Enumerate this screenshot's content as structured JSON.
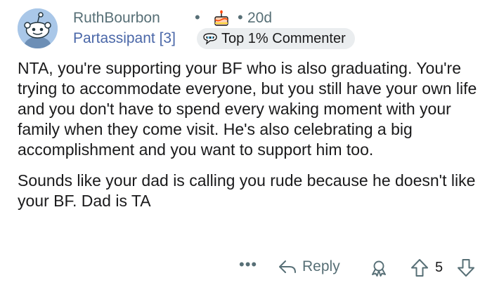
{
  "comment": {
    "author": {
      "username": "RuthBourbon",
      "flair": "Partassipant [3]",
      "badge": "Top 1% Commenter",
      "age": "20d",
      "separator": "•"
    },
    "body": {
      "paragraph1": "NTA, you're supporting your BF who is also graduating. You're trying to accommodate everyone, but you still have your own life and you don't have to spend every waking moment with your family when they come visit. He's also celebrating a big accomplishment and you want to support him too.",
      "paragraph2": "Sounds like your dad is calling you rude because he doesn't like your BF. Dad is TA"
    },
    "actions": {
      "more": "•••",
      "reply_label": "Reply",
      "score": "5"
    },
    "icons": {
      "avatar": "snoo-avatar",
      "cake": "cake-day-icon",
      "badge": "top-commenter-icon",
      "reply": "reply-arrow-icon",
      "award": "award-icon",
      "upvote": "upvote-arrow-icon",
      "downvote": "downvote-arrow-icon"
    },
    "colors": {
      "meta_text": "#576f76",
      "flair_text": "#4a67a8",
      "badge_bg": "#eaedef",
      "avatar_bg": "#a9c7e8"
    }
  }
}
